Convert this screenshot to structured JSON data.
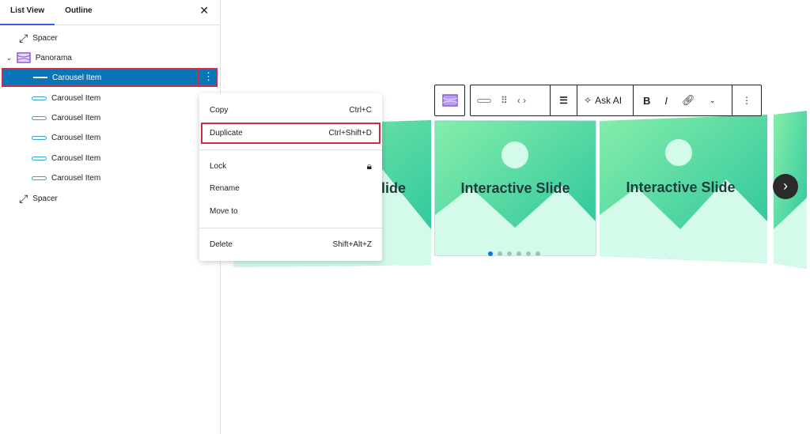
{
  "sidebar": {
    "tabs": [
      {
        "label": "List View"
      },
      {
        "label": "Outline"
      }
    ],
    "items": [
      {
        "label": "Spacer",
        "icon": "resize-icon"
      },
      {
        "label": "Panorama",
        "icon": "panorama-icon"
      },
      {
        "label": "Carousel Item"
      },
      {
        "label": "Carousel Item"
      },
      {
        "label": "Carousel Item"
      },
      {
        "label": "Carousel Item"
      },
      {
        "label": "Carousel Item"
      },
      {
        "label": "Carousel Item"
      },
      {
        "label": "Spacer",
        "icon": "resize-icon"
      }
    ]
  },
  "menu": {
    "copy": {
      "label": "Copy",
      "shortcut": "Ctrl+C"
    },
    "duplicate": {
      "label": "Duplicate",
      "shortcut": "Ctrl+Shift+D"
    },
    "lock": {
      "label": "Lock"
    },
    "rename": {
      "label": "Rename"
    },
    "move": {
      "label": "Move to"
    },
    "delete": {
      "label": "Delete",
      "shortcut": "Shift+Alt+Z"
    }
  },
  "toolbar": {
    "ask_ai": "Ask AI",
    "bold": "B",
    "italic": "I"
  },
  "slides": {
    "title": "Interactive Slide",
    "partial_title": "lide",
    "dots": 6,
    "active_dot": 0
  },
  "colors": {
    "accent": "#0a76b8",
    "highlight": "#c8303f",
    "slide_dark": "#2ec99a",
    "slide_light": "#d4fbe9"
  }
}
